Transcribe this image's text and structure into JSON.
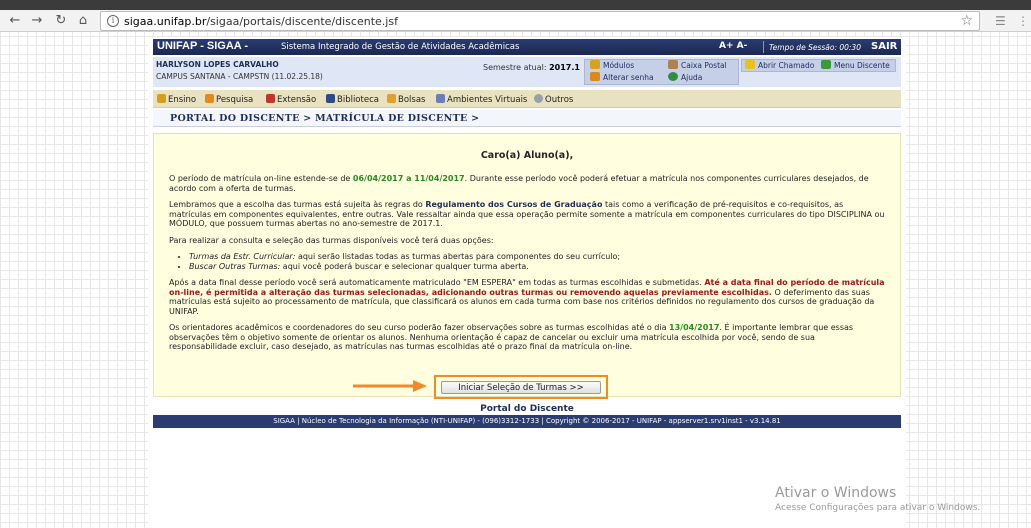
{
  "browser": {
    "url_host": "sigaa.unifap.br",
    "url_path": "/sigaa/portais/discente/discente.jsf",
    "back_icon": "arrow-left-icon",
    "forward_icon": "arrow-right-icon",
    "reload_icon": "reload-icon",
    "home_icon": "home-icon",
    "info_label": "i"
  },
  "header": {
    "brand": "UNIFAP - SIGAA -",
    "system_name": "Sistema Integrado de Gestão de Atividades Acadêmicas",
    "font_controls": "A+ A-",
    "session_label": "Tempo de Sessão: 00:30",
    "logout": "SAIR"
  },
  "user": {
    "name": "HARLYSON LOPES CARVALHO",
    "campus": "CAMPUS SANTANA - CAMPSTN (11.02.25.18)",
    "semester_label": "Semestre atual:",
    "semester_value": "2017.1"
  },
  "quick_links": {
    "modulos": "Módulos",
    "caixa_postal": "Caixa Postal",
    "abrir_chamado": "Abrir Chamado",
    "menu_discente": "Menu Discente",
    "alterar_senha": "Alterar senha",
    "ajuda": "Ajuda"
  },
  "menu": {
    "ensino": "Ensino",
    "pesquisa": "Pesquisa",
    "extensao": "Extensão",
    "biblioteca": "Biblioteca",
    "bolsas": "Bolsas",
    "ambientes": "Ambientes Virtuais",
    "outros": "Outros"
  },
  "breadcrumb": "PORTAL DO DISCENTE > MATRÍCULA DE DISCENTE >",
  "notice": {
    "greeting": "Caro(a) Aluno(a),",
    "p1_a": "O período de matrícula on-line estende-se de ",
    "p1_dates": "06/04/2017 a 11/04/2017",
    "p1_b": ". Durante esse período você poderá efetuar a matrícula nos componentes curriculares desejados, de acordo com a oferta de turmas.",
    "p2_a": "Lembramos que a escolha das turmas está sujeita às regras do ",
    "p2_link": "Regulamento dos Cursos de Graduação",
    "p2_b": " tais como a verificação de pré-requisitos e co-requisitos, as matrículas em componentes equivalentes, entre outras. Vale ressaltar ainda que essa operação permite somente a matrícula em componentes curriculares do tipo DISCIPLINA ou MÓDULO, que possuem turmas abertas no ano-semestre de 2017.1.",
    "p3": "Para realizar a consulta e seleção das turmas disponíveis você terá duas opções:",
    "opt1_label": "Turmas da Estr. Curricular:",
    "opt1_text": " aqui serão listadas todas as turmas abertas para componentes do seu currículo;",
    "opt2_label": "Buscar Outras Turmas:",
    "opt2_text": " aqui você poderá buscar e selecionar qualquer turma aberta.",
    "p4_a": "Após a data final desse período você será automaticamente matriculado \"EM ESPERA\" em todas as turmas escolhidas e submetidas. ",
    "p4_red": "Até a data final do período de matrícula on-line, é permitida a alteração das turmas selecionadas, adicionando outras turmas ou removendo aquelas previamente escolhidas.",
    "p4_b": " O deferimento das suas matrículas está sujeito ao processamento de matrícula, que classificará os alunos em cada turma com base nos critérios definidos no regulamento dos cursos de graduação da UNIFAP.",
    "p5_a": "Os orientadores acadêmicos e coordenadores do seu curso poderão fazer observações sobre as turmas escolhidas até o dia ",
    "p5_date": "13/04/2017",
    "p5_b": ". É importante lembrar que essas observações têm o objetivo somente de orientar os alunos. Nenhuma orientação é capaz de cancelar ou excluir uma matrícula escolhida por você, sendo de sua responsabilidade excluir, caso desejado, as matrículas nas turmas escolhidas até o prazo final da matrícula on-line."
  },
  "action": {
    "start_button": "Iniciar Seleção de Turmas >>"
  },
  "portal_link": "Portal do Discente",
  "footer": "SIGAA | Núcleo de Tecnologia da Informação (NTI-UNIFAP) - (096)3312-1733 | Copyright © 2006-2017 - UNIFAP - appserver1.srv1inst1 - v3.14.81",
  "watermark": {
    "title": "Ativar o Windows",
    "subtitle": "Acesse Configurações para ativar o Windows."
  },
  "colors": {
    "header_bg": "#2b3c70",
    "notice_bg": "#ffffe0",
    "highlight_orange": "#f08a2c",
    "date_green": "#2a8a1e",
    "warning_red": "#a31616"
  }
}
